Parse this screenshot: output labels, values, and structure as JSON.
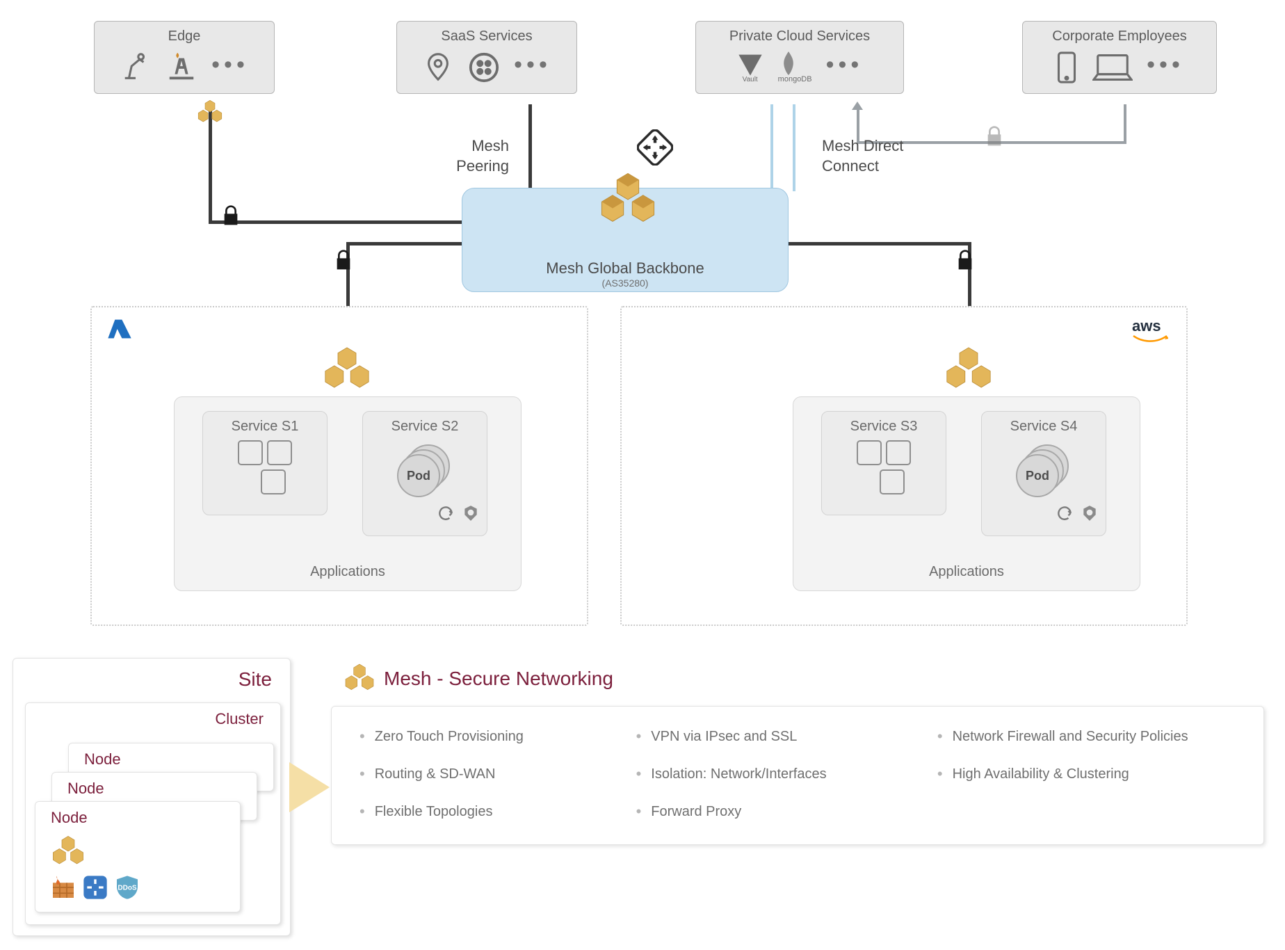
{
  "top_cards": {
    "edge": {
      "title": "Edge"
    },
    "saas": {
      "title": "SaaS Services"
    },
    "pcloud": {
      "title": "Private Cloud Services",
      "icon_labels": [
        "Vault",
        "mongoDB"
      ]
    },
    "corp": {
      "title": "Corporate Employees"
    }
  },
  "conn_labels": {
    "peering": "Mesh\nPeering",
    "direct": "Mesh Direct\nConnect"
  },
  "backbone": {
    "title": "Mesh Global Backbone",
    "subtitle": "(AS35280)"
  },
  "clouds": {
    "azure": {
      "corner_icon": "azure",
      "applications_label": "Applications",
      "services": [
        {
          "label": "Service S1",
          "kind": "squares"
        },
        {
          "label": "Service S2",
          "kind": "pod",
          "pod_text": "Pod"
        }
      ]
    },
    "aws": {
      "corner_icon": "aws",
      "applications_label": "Applications",
      "services": [
        {
          "label": "Service S3",
          "kind": "squares"
        },
        {
          "label": "Service S4",
          "kind": "pod",
          "pod_text": "Pod"
        }
      ]
    }
  },
  "site_stack": {
    "site_label": "Site",
    "cluster_label": "Cluster",
    "node_label": "Node"
  },
  "features": {
    "title": "Mesh - Secure Networking",
    "items": [
      "Zero Touch Provisioning",
      "VPN via IPsec and SSL",
      "Network Firewall and Security Policies",
      "Routing & SD-WAN",
      "Isolation: Network/Interfaces",
      "High Availability & Clustering",
      "Flexible Topologies",
      "Forward Proxy"
    ]
  },
  "icon_names": {
    "router": "router-icon",
    "lock": "lock-icon",
    "mesh_cubes": "mesh-cubes-icon",
    "kubernetes": "kubernetes-icon",
    "sync": "sync-icon",
    "firewall": "firewall-icon",
    "shield": "shield-icon"
  }
}
